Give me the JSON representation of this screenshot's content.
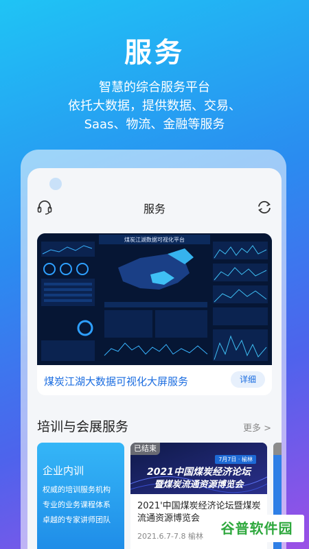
{
  "hero": {
    "title": "服务",
    "subtitle_lines": [
      "智慧的综合服务平台",
      "依托大数据，提供数据、交易、",
      "Saas、物流、金融等服务"
    ]
  },
  "app": {
    "header_title": "服务",
    "left_icon": "headset-icon",
    "right_icon": "refresh-icon"
  },
  "banner": {
    "dashboard_heading": "煤炭江湖数据可视化平台",
    "caption": "煤炭江湖大数据可视化大屏服务",
    "detail_label": "详细"
  },
  "training": {
    "section_title": "培训与会展服务",
    "more_label": "更多 >",
    "card": {
      "title": "企业内训",
      "lines": [
        "权威的培训服务机构",
        "专业的业务课程体系",
        "卓越的专家讲师团队"
      ]
    },
    "event": {
      "status": "已结束",
      "date_chip": "7月7日 · 榆林",
      "image_line1": "2021中国煤炭经济论坛",
      "image_line2": "暨煤炭流通资源博览会",
      "title": "2021'中国煤炭经济论坛暨煤炭流通资源博览会",
      "meta": "2021.6.7-7.8 榆林"
    }
  },
  "watermark": "谷普软件园",
  "colors": {
    "accent": "#1b6de0",
    "card_blue": "#2a9cf0",
    "dashboard_bg": "#061634"
  }
}
